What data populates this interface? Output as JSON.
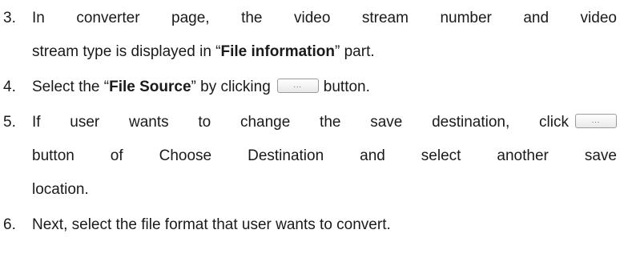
{
  "items": [
    {
      "number": "3.",
      "lines": [
        [
          "In",
          "converter",
          "page,",
          "the",
          "video",
          "stream",
          "number",
          "and",
          "video"
        ],
        {
          "pre": "stream type is displayed in “",
          "bold": "File information",
          "post": "” part."
        }
      ]
    },
    {
      "number": "4.",
      "pre": "Select the “",
      "bold": "File Source",
      "post": "” by clicking",
      "button_glyph": "...",
      "after": "button."
    },
    {
      "number": "5.",
      "first_line": [
        "If",
        "user",
        "wants",
        "to",
        "change",
        "the",
        "save",
        "destination,",
        "click"
      ],
      "button_glyph": "...",
      "second_line": [
        "button",
        "of",
        "Choose",
        "Destination",
        "and",
        "select",
        "another",
        "save"
      ],
      "third_line": "location."
    },
    {
      "number": "6.",
      "text": "Next, select the file format that user wants to convert."
    }
  ]
}
